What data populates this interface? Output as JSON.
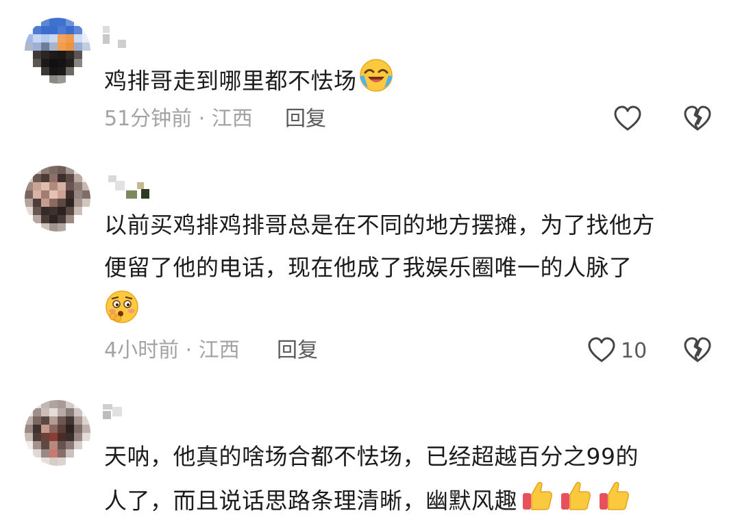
{
  "comments": [
    {
      "text": "鸡排哥走到哪里都不怯场",
      "text_line2": "",
      "time_location": "51分钟前 · 江西",
      "reply_label": "回复",
      "like_count": "",
      "emoji": "laughing-crying-emoji-icon"
    },
    {
      "text": "以前买鸡排鸡排哥总是在不同的地方摆摊，为了找他方",
      "text_line2": "便留了他的电话，现在他成了我娱乐圈唯一的人脉了",
      "time_location": "4小时前 · 江西",
      "reply_label": "回复",
      "like_count": "10",
      "emoji": "blushing-emoji-icon"
    },
    {
      "text": "天呐，他真的啥场合都不怯场，已经超越百分之99的",
      "text_line2": "人了，而且说话思路条理清晰，幽默风趣",
      "time_location": "",
      "reply_label": "",
      "like_count": "",
      "emoji": "thumbs-up-emoji-icon"
    }
  ],
  "colors": {
    "meta_text": "#a3a3a3",
    "reply_text": "#5a5a5a",
    "body_text": "#1c1c1c",
    "icon_stroke": "#444444"
  }
}
